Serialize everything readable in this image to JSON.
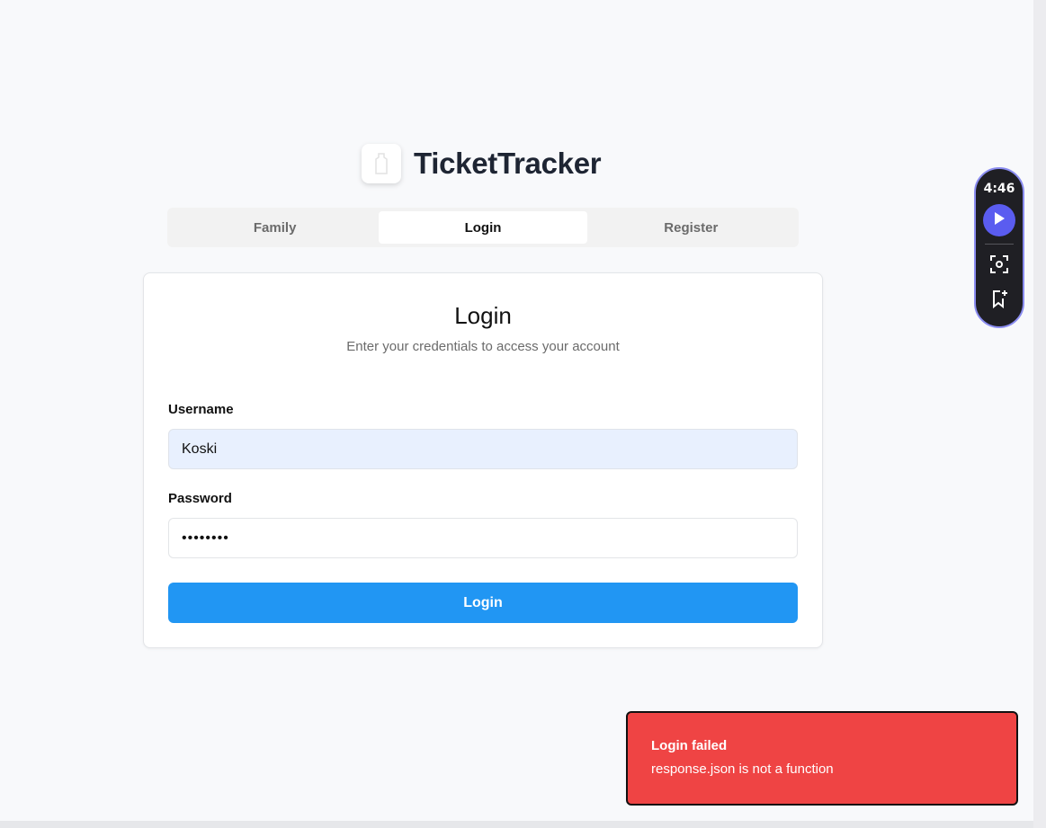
{
  "app": {
    "title": "TicketTracker"
  },
  "tabs": [
    {
      "label": "Family"
    },
    {
      "label": "Login"
    },
    {
      "label": "Register"
    }
  ],
  "card": {
    "title": "Login",
    "subtitle": "Enter your credentials to access your account",
    "username_label": "Username",
    "username_value": "Koski",
    "password_label": "Password",
    "password_value": "••••••••",
    "submit_label": "Login"
  },
  "recorder": {
    "time": "4:46"
  },
  "toast": {
    "title": "Login failed",
    "message": "response.json is not a function"
  },
  "colors": {
    "primary": "#2196f3",
    "error": "#ef4444",
    "recorder_accent": "#5a5cf0"
  }
}
